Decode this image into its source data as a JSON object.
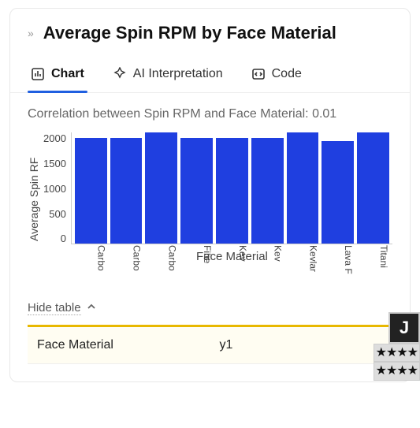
{
  "header": {
    "title": "Average Spin RPM by Face Material"
  },
  "tabs": {
    "chart": "Chart",
    "ai": "AI Interpretation",
    "code": "Code"
  },
  "chart_data": {
    "type": "bar",
    "title": "Correlation between Spin RPM and Face Material: 0.01",
    "xlabel": "Face Material",
    "ylabel": "Average Spin RPM",
    "ylabel_truncated": "Average Spin RF",
    "categories": [
      "Carbo",
      "Carbo",
      "Carbo",
      "Fibe",
      "Kev",
      "Kev",
      "Kevlar",
      "Lava F",
      "Titani"
    ],
    "values": [
      1900,
      1900,
      2000,
      1900,
      1900,
      1900,
      2000,
      1850,
      2000
    ],
    "yticks": [
      "2000",
      "1500",
      "1000",
      "500",
      "0"
    ],
    "ylim": [
      0,
      2000
    ]
  },
  "table": {
    "toggle_label": "Hide table",
    "headers": [
      "Face Material",
      "y1"
    ]
  },
  "rating": {
    "badge": "J",
    "row": "★★★★",
    "row2": "★★★★"
  }
}
